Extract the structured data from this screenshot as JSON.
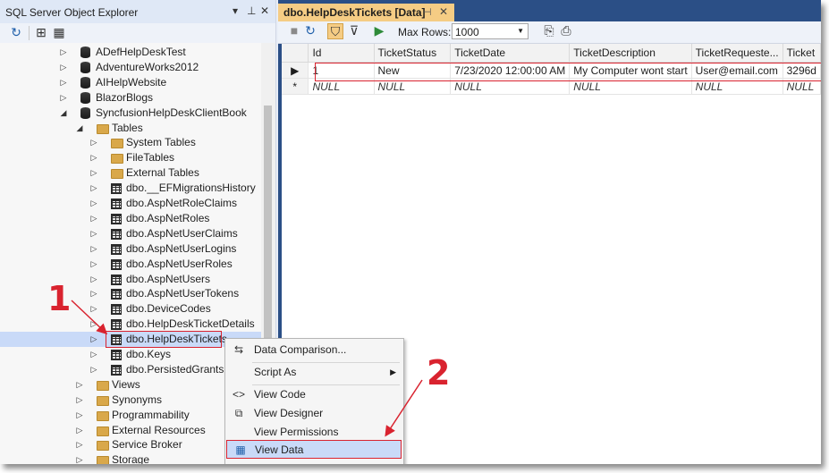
{
  "object_explorer": {
    "title": "SQL Server Object Explorer",
    "title_controls": [
      "▾",
      "ᵖ",
      "✕"
    ],
    "toolbar_icons": [
      "refresh-icon",
      "add-server-icon",
      "filter-icon"
    ],
    "tree": [
      {
        "label": "ADefHelpDeskTest",
        "icon": "database-icon",
        "expanded": false,
        "level": 1
      },
      {
        "label": "AdventureWorks2012",
        "icon": "database-icon",
        "expanded": false,
        "level": 1
      },
      {
        "label": "AIHelpWebsite",
        "icon": "database-icon",
        "expanded": false,
        "level": 1
      },
      {
        "label": "BlazorBlogs",
        "icon": "database-icon",
        "expanded": false,
        "level": 1
      },
      {
        "label": "SyncfusionHelpDeskClientBook",
        "icon": "database-icon",
        "expanded": true,
        "level": 1
      },
      {
        "label": "Tables",
        "icon": "folder-open-icon",
        "expanded": true,
        "level": 2
      },
      {
        "label": "System Tables",
        "icon": "folder-icon",
        "expanded": false,
        "level": 3
      },
      {
        "label": "FileTables",
        "icon": "folder-icon",
        "expanded": false,
        "level": 3
      },
      {
        "label": "External Tables",
        "icon": "folder-icon",
        "expanded": false,
        "level": 3
      },
      {
        "label": "dbo.__EFMigrationsHistory",
        "icon": "table-icon",
        "expanded": false,
        "level": 3
      },
      {
        "label": "dbo.AspNetRoleClaims",
        "icon": "table-icon",
        "expanded": false,
        "level": 3
      },
      {
        "label": "dbo.AspNetRoles",
        "icon": "table-icon",
        "expanded": false,
        "level": 3
      },
      {
        "label": "dbo.AspNetUserClaims",
        "icon": "table-icon",
        "expanded": false,
        "level": 3
      },
      {
        "label": "dbo.AspNetUserLogins",
        "icon": "table-icon",
        "expanded": false,
        "level": 3
      },
      {
        "label": "dbo.AspNetUserRoles",
        "icon": "table-icon",
        "expanded": false,
        "level": 3
      },
      {
        "label": "dbo.AspNetUsers",
        "icon": "table-icon",
        "expanded": false,
        "level": 3
      },
      {
        "label": "dbo.AspNetUserTokens",
        "icon": "table-icon",
        "expanded": false,
        "level": 3
      },
      {
        "label": "dbo.DeviceCodes",
        "icon": "table-icon",
        "expanded": false,
        "level": 3
      },
      {
        "label": "dbo.HelpDeskTicketDetails",
        "icon": "table-icon",
        "expanded": false,
        "level": 3
      },
      {
        "label": "dbo.HelpDeskTickets",
        "icon": "table-icon",
        "expanded": false,
        "level": 3,
        "selected": true
      },
      {
        "label": "dbo.Keys",
        "icon": "table-icon",
        "expanded": false,
        "level": 3
      },
      {
        "label": "dbo.PersistedGrants",
        "icon": "table-icon",
        "expanded": false,
        "level": 3
      },
      {
        "label": "Views",
        "icon": "folder-icon",
        "expanded": false,
        "level": 2
      },
      {
        "label": "Synonyms",
        "icon": "folder-icon",
        "expanded": false,
        "level": 2
      },
      {
        "label": "Programmability",
        "icon": "folder-icon",
        "expanded": false,
        "level": 2
      },
      {
        "label": "External Resources",
        "icon": "folder-icon",
        "expanded": false,
        "level": 2
      },
      {
        "label": "Service Broker",
        "icon": "folder-icon",
        "expanded": false,
        "level": 2
      },
      {
        "label": "Storage",
        "icon": "folder-icon",
        "expanded": false,
        "level": 2
      }
    ]
  },
  "data_window": {
    "tab_title": "dbo.HelpDeskTickets [Data]",
    "max_rows_label": "Max Rows:",
    "max_rows_value": "1000",
    "columns": [
      "Id",
      "TicketStatus",
      "TicketDate",
      "TicketDescription",
      "TicketRequeste...",
      "Ticket"
    ],
    "rows": [
      {
        "marker": "▶",
        "cells": [
          "1",
          "New",
          "7/23/2020 12:00:00 AM",
          "My Computer wont start",
          "User@email.com",
          "3296d"
        ]
      },
      {
        "marker": "*",
        "cells": [
          "NULL",
          "NULL",
          "NULL",
          "NULL",
          "NULL",
          "NULL"
        ],
        "is_null": true
      }
    ]
  },
  "context_menu": {
    "items": [
      {
        "label": "Data Comparison...",
        "icon": "data-compare-icon"
      },
      {
        "label": "Script As",
        "submenu": true
      },
      {
        "label": "View Code",
        "icon": "code-icon"
      },
      {
        "label": "View Designer",
        "icon": "designer-icon"
      },
      {
        "label": "View Permissions"
      },
      {
        "label": "View Data",
        "icon": "grid-icon",
        "active": true
      }
    ]
  },
  "annotations": {
    "step1": "1",
    "step2": "2",
    "color": "#d9232f"
  }
}
